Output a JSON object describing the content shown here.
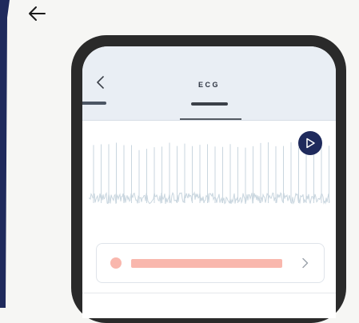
{
  "header": {
    "title": "ECG"
  },
  "icons": {
    "back": "arrow-left-icon",
    "screen_back": "chevron-left-icon",
    "play": "play-icon",
    "chevron": "chevron-right-icon"
  },
  "colors": {
    "accent_dark_blue": "#1f2a5c",
    "record_pink": "#f9b7ad",
    "header_bg": "#e9eef4",
    "phone_frame": "#2a2a2a",
    "ecg_trace": "#c9d6df"
  }
}
